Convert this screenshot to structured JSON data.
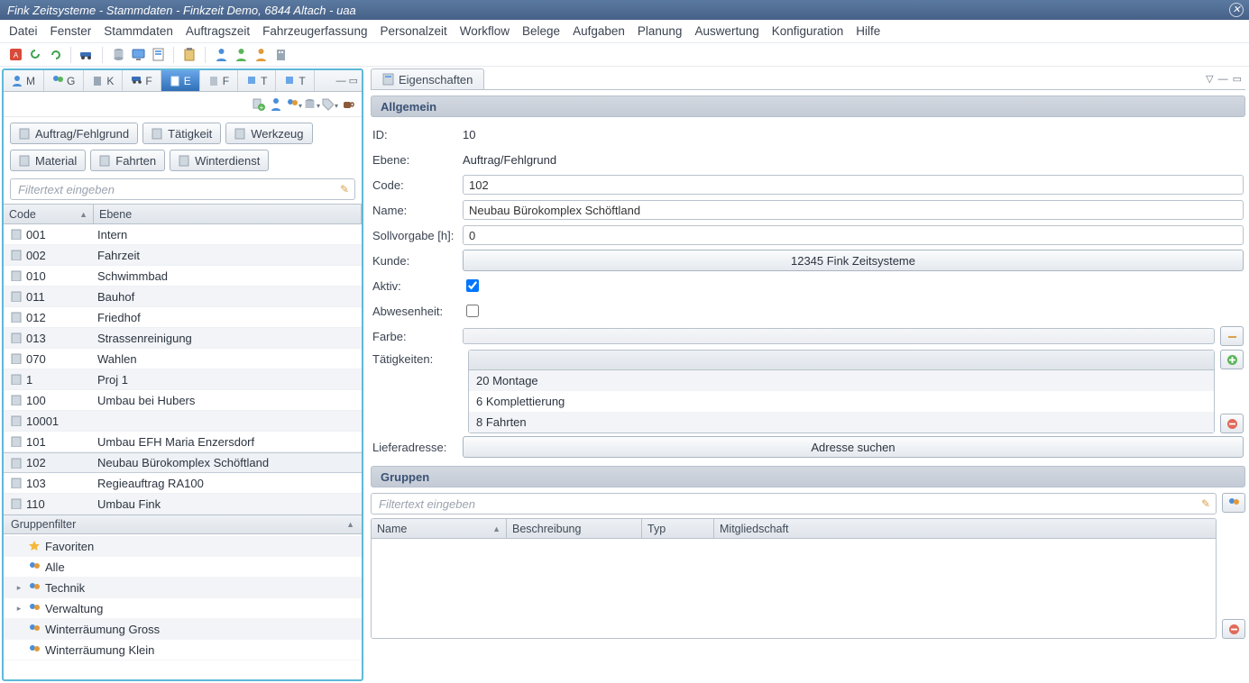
{
  "window": {
    "title": "Fink Zeitsysteme - Stammdaten - Finkzeit Demo, 6844 Altach - uaa"
  },
  "menubar": [
    "Datei",
    "Fenster",
    "Stammdaten",
    "Auftragszeit",
    "Fahrzeugerfassung",
    "Personalzeit",
    "Workflow",
    "Belege",
    "Aufgaben",
    "Planung",
    "Auswertung",
    "Konfiguration",
    "Hilfe"
  ],
  "viewtabs": [
    {
      "label": "M"
    },
    {
      "label": "G"
    },
    {
      "label": "K"
    },
    {
      "label": "F"
    },
    {
      "label": "E",
      "active": true
    },
    {
      "label": "F"
    },
    {
      "label": "T"
    },
    {
      "label": "T"
    }
  ],
  "filterButtons": {
    "row1": [
      "Auftrag/Fehlgrund",
      "Tätigkeit",
      "Werkzeug"
    ],
    "row2": [
      "Material",
      "Fahrten",
      "Winterdienst"
    ]
  },
  "filter": {
    "placeholder": "Filtertext eingeben"
  },
  "gridHeaders": {
    "code": "Code",
    "ebene": "Ebene"
  },
  "rows": [
    {
      "code": "001",
      "ebene": "Intern"
    },
    {
      "code": "002",
      "ebene": "Fahrzeit"
    },
    {
      "code": "010",
      "ebene": "Schwimmbad"
    },
    {
      "code": "011",
      "ebene": "Bauhof"
    },
    {
      "code": "012",
      "ebene": "Friedhof"
    },
    {
      "code": "013",
      "ebene": "Strassenreinigung"
    },
    {
      "code": "070",
      "ebene": "Wahlen"
    },
    {
      "code": "1",
      "ebene": "Proj 1"
    },
    {
      "code": "100",
      "ebene": "Umbau bei Hubers"
    },
    {
      "code": "10001",
      "ebene": ""
    },
    {
      "code": "101",
      "ebene": "Umbau EFH Maria Enzersdorf"
    },
    {
      "code": "102",
      "ebene": "Neubau Bürokomplex Schöftland",
      "selected": true
    },
    {
      "code": "103",
      "ebene": "Regieauftrag RA100"
    },
    {
      "code": "110",
      "ebene": "Umbau Fink"
    }
  ],
  "gruppenfilter": {
    "title": "Gruppenfilter",
    "nodes": [
      {
        "icon": "star",
        "label": "Favoriten",
        "expander": ""
      },
      {
        "icon": "group",
        "label": "Alle",
        "expander": ""
      },
      {
        "icon": "group",
        "label": "Technik",
        "expander": "▸"
      },
      {
        "icon": "group",
        "label": "Verwaltung",
        "expander": "▸"
      },
      {
        "icon": "group",
        "label": "Winterräumung Gross",
        "expander": ""
      },
      {
        "icon": "group",
        "label": "Winterräumung Klein",
        "expander": ""
      }
    ]
  },
  "rightTab": {
    "label": "Eigenschaften"
  },
  "sections": {
    "allgemein": "Allgemein",
    "gruppen": "Gruppen"
  },
  "labels": {
    "id": "ID:",
    "ebene": "Ebene:",
    "code": "Code:",
    "name": "Name:",
    "soll": "Sollvorgabe [h]:",
    "kunde": "Kunde:",
    "aktiv": "Aktiv:",
    "abw": "Abwesenheit:",
    "farbe": "Farbe:",
    "taet": "Tätigkeiten:",
    "lief": "Lieferadresse:"
  },
  "values": {
    "id": "10",
    "ebene": "Auftrag/Fehlgrund",
    "code": "102",
    "name": "Neubau Bürokomplex Schöftland",
    "soll": "0",
    "kunde": "12345 Fink Zeitsysteme",
    "aktiv": true,
    "abw": false,
    "adresse_btn": "Adresse suchen"
  },
  "taetigkeiten": [
    "20 Montage",
    "6 Komplettierung",
    "8 Fahrten"
  ],
  "gruppenFilter2": {
    "placeholder": "Filtertext eingeben"
  },
  "gruppenCols": {
    "name": "Name",
    "besch": "Beschreibung",
    "typ": "Typ",
    "mit": "Mitgliedschaft"
  }
}
